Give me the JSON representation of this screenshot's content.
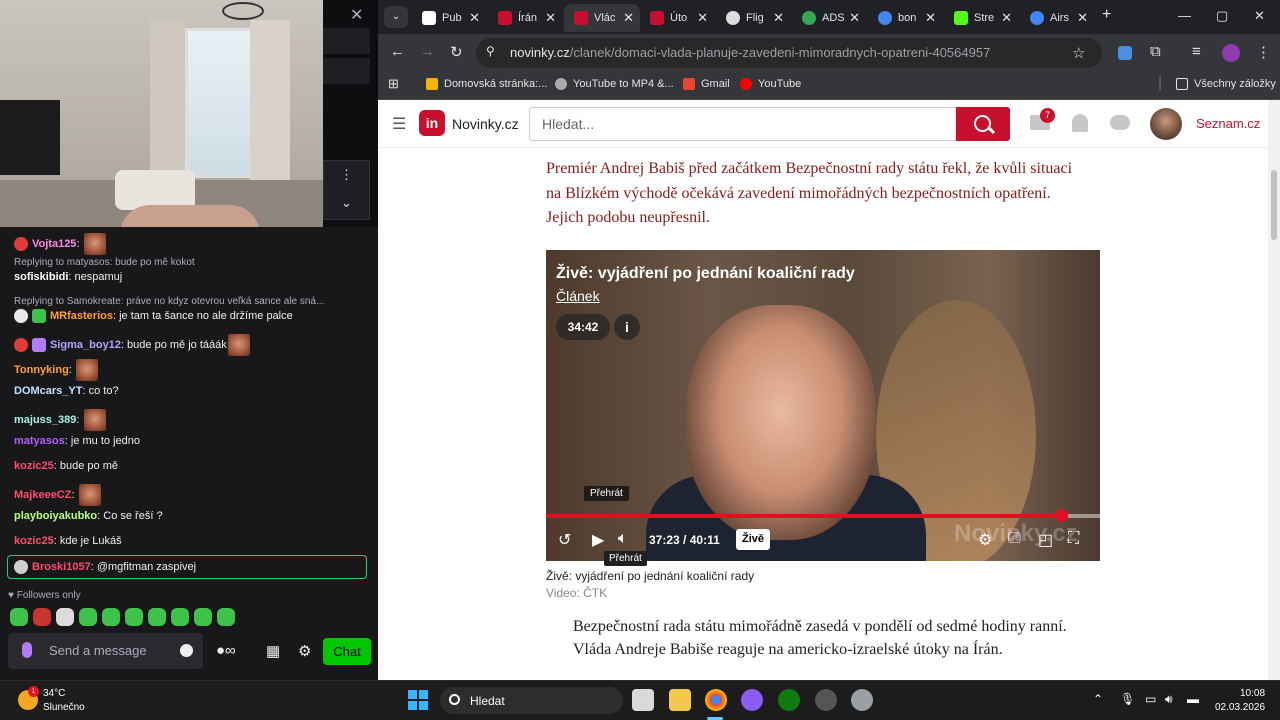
{
  "chat": {
    "messages": [
      {
        "user": "Vojta125",
        "text": "",
        "user_color": "#ff8ce3"
      },
      {
        "reply": "Replying to matyasos: bude po mě kokot"
      },
      {
        "user": "sofiskibidi",
        "text": "nespamuj",
        "user_color": "#ffffff"
      },
      {
        "reply": "Replying to Samokreate: práve no kdyz otevrou veľká sance ale sná..."
      },
      {
        "user": "MRfasterios",
        "text": "je tam ta šance no ale držíme palce",
        "user_color": "#ff9f2e"
      },
      {
        "user": "Sigma_boy12",
        "text": "bude po mě jo tááák",
        "user_color": "#b4a6ff"
      },
      {
        "user": "Tonnyking",
        "text": "",
        "user_color": "#ff9f2e"
      },
      {
        "user": "DOMcars_YT",
        "text": "co to?",
        "user_color": "#bfe3ff"
      },
      {
        "user": "majuss_389",
        "text": "",
        "user_color": "#a5f2e6"
      },
      {
        "user": "matyasos",
        "text": "je mu to jedno",
        "user_color": "#b45cff"
      },
      {
        "user": "kozic25",
        "text": "bude po mě",
        "user_color": "#ff4d6a"
      },
      {
        "user": "MajkeeeCZ",
        "text": "",
        "user_color": "#ff4d6a"
      },
      {
        "user": "playboiyakubko",
        "text": "Co se řeší ?",
        "user_color": "#b7ff7a"
      },
      {
        "user": "kozic25",
        "text": "kde je Lukáš",
        "user_color": "#ff4d6a"
      },
      {
        "user": "Broski1057",
        "text": "@mgfitman zaspivej",
        "user_color": "#ff4d6a"
      }
    ],
    "followers_only": "Followers only",
    "input_placeholder": "Send a message",
    "chat_button": "Chat"
  },
  "browser": {
    "tabs": [
      {
        "label": "Pub",
        "color": "#ffffff"
      },
      {
        "label": "Írán",
        "color": "#c8102e"
      },
      {
        "label": "Vlác",
        "color": "#c8102e"
      },
      {
        "label": "Úto",
        "color": "#c8102e"
      },
      {
        "label": "Flig",
        "color": "#dddddd"
      },
      {
        "label": "ADS",
        "color": "#34a853"
      },
      {
        "label": "bon",
        "color": "#4285f4"
      },
      {
        "label": "Stre",
        "color": "#53fc18"
      },
      {
        "label": "Airs",
        "color": "#4285f4"
      }
    ],
    "url_host": "novinky.cz",
    "url_path": "/clanek/domaci-vlada-planuje-zavedeni-mimoradnych-opatreni-40564957",
    "bookmarks": [
      "Domovská stránka:...",
      "YouTube to MP4 &...",
      "Gmail",
      "YouTube"
    ],
    "all_bookmarks": "Všechny záložky"
  },
  "site": {
    "logo_letters": "in",
    "logo_text": "Novinky.cz",
    "search_placeholder": "Hledat...",
    "mail_count": "7",
    "account": "Seznam.cz",
    "lead": "Premiér Andrej Babiš před začátkem Bezpečnostní rady státu řekl, že kvůli situaci na Blízkém východě očekává zavedení mimořádných bezpečnostních opatření. Jejich podobu neupřesnil.",
    "video": {
      "title": "Živě: vyjádření po jednání koaliční rady",
      "link": "Článek",
      "duration": "34:42",
      "info": "i",
      "tooltip": "Přehrát",
      "current_time": "37:23",
      "separator": "/",
      "total_time": "40:11",
      "live_label": "Živě",
      "watermark": "Novinky.cz",
      "progress_fraction": 0.929
    },
    "tooltip_below": "Přehrát",
    "caption": "Živě: vyjádření po jednání koaliční rady",
    "credit": "Video: ČTK",
    "body": "Bezpečnostní rada státu mimořádně zasedá v pondělí od sedmé hodiny ranní. Vláda Andreje Babiše reaguje na americko-izraelské útoky na Írán."
  },
  "taskbar": {
    "weather_badge": "1",
    "temperature": "34°C",
    "condition": "Slunečno",
    "search_label": "Hledat",
    "time": "10:08",
    "date": "02.03.2026"
  }
}
